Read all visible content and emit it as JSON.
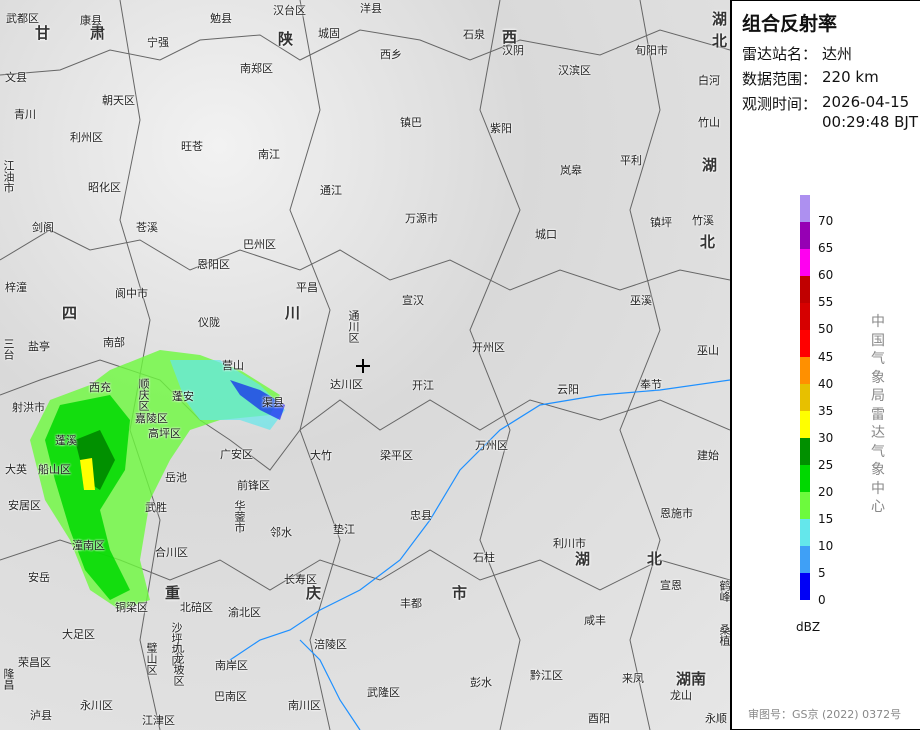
{
  "panel": {
    "title": "组合反射率",
    "station_label": "雷达站名：",
    "station": "达州",
    "range_label": "数据范围：",
    "range": "220 km",
    "time_label": "观测时间：",
    "date": "2026-04-15",
    "time": "00:29:48 BJT",
    "legend": {
      "unit": "dBZ",
      "ticks": [
        "70",
        "65",
        "60",
        "55",
        "50",
        "45",
        "40",
        "35",
        "30",
        "25",
        "20",
        "15",
        "10",
        "5",
        "0"
      ],
      "colors_top_to_bottom": [
        "#ad90f0",
        "#9600b4",
        "#ff00f0",
        "#c00000",
        "#d60000",
        "#ff0000",
        "#ff9000",
        "#e7c000",
        "#ffff00",
        "#019000",
        "#00d800",
        "#6dfa3d",
        "#64e7eb",
        "#3fa0f6",
        "#0000f6"
      ]
    },
    "agency": "中国气象局雷达气象中心",
    "approval": "审图号：GS京 (2022) 0372号"
  },
  "map": {
    "provinces": [
      "甘",
      "肃",
      "陕",
      "西",
      "湖",
      "北",
      "湖",
      "北",
      "四",
      "川",
      "湖",
      "北",
      "重",
      "庆",
      "市",
      "湖南"
    ],
    "labels": [
      "武都区",
      "康县",
      "勉县",
      "汉台区",
      "洋县",
      "石泉",
      "汉阴",
      "旬阳市",
      "白河",
      "宁强",
      "城固",
      "西乡",
      "汉滨区",
      "南郑区",
      "文县",
      "朝天区",
      "青川",
      "镇巴",
      "紫阳",
      "竹山",
      "利州区",
      "旺苍",
      "南江",
      "岚皋",
      "平利",
      "江油市",
      "昭化区",
      "通江",
      "万源市",
      "镇坪",
      "竹溪",
      "剑阁",
      "苍溪",
      "巴州区",
      "城口",
      "恩阳区",
      "梓潼",
      "阆中市",
      "平昌",
      "宣汉",
      "巫溪",
      "仪陇",
      "通川区",
      "南部",
      "开州区",
      "巫山",
      "盐亭",
      "三台",
      "营山",
      "达川区",
      "开江",
      "云阳",
      "奉节",
      "西充",
      "顺庆区",
      "蓬安",
      "渠县",
      "射洪市",
      "嘉陵区",
      "高坪区",
      "大竹",
      "梁平区",
      "万州区",
      "建始",
      "蓬溪",
      "广安区",
      "大英",
      "船山区",
      "岳池",
      "前锋区",
      "安居区",
      "武胜",
      "华蓥市",
      "邻水",
      "垫江",
      "忠县",
      "恩施市",
      "潼南区",
      "合川区",
      "利川市",
      "石柱",
      "安岳",
      "长寿区",
      "宣恩",
      "鹤峰",
      "丰都",
      "铜梁区",
      "北碚区",
      "渝北区",
      "咸丰",
      "大足区",
      "沙坪坝区",
      "桑植",
      "涪陵区",
      "荣昌区",
      "璧山区",
      "九龙坡区",
      "南岸区",
      "黔江区",
      "来凤",
      "彭水",
      "武隆区",
      "巴南区",
      "南川区",
      "永川区",
      "龙山",
      "泸县",
      "江津区",
      "酉阳",
      "永顺",
      "隆昌"
    ]
  }
}
